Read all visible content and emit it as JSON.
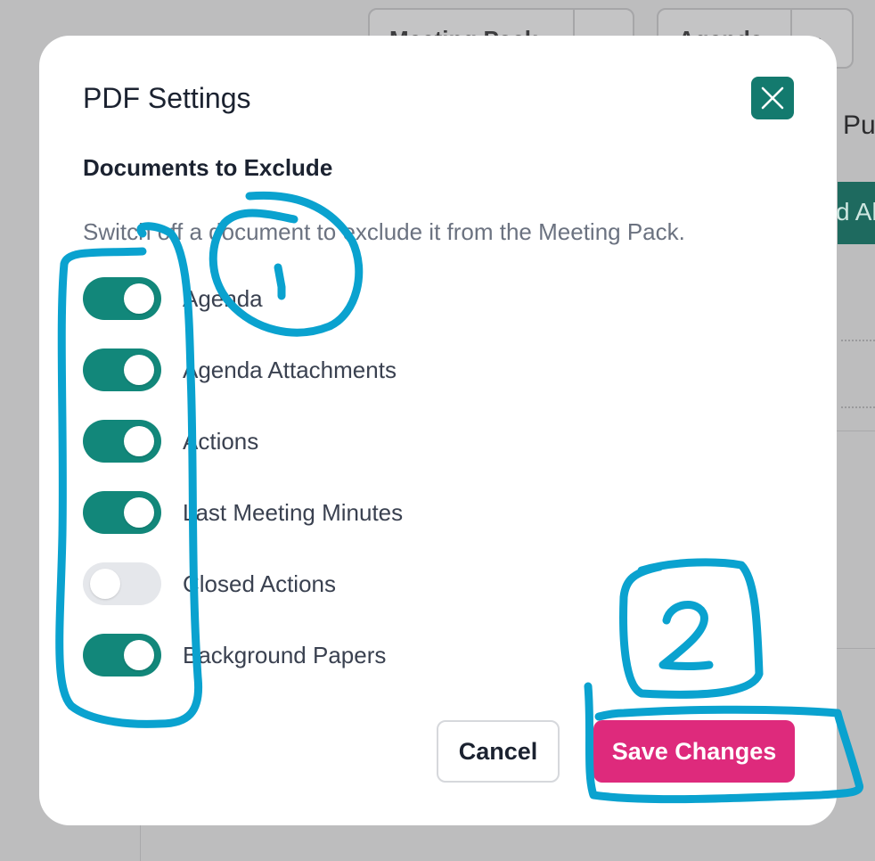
{
  "background": {
    "select1_text": "Meeting Pack",
    "select2_text": "Agenda",
    "partial_right_text": "Pu",
    "partial_green_text": "d Al"
  },
  "modal": {
    "title": "PDF Settings",
    "close_icon": "close-x-icon",
    "section_title": "Documents to Exclude",
    "hint": "Switch off a document to exclude it from the Meeting Pack.",
    "toggles": [
      {
        "label": "Agenda",
        "on": true
      },
      {
        "label": "Agenda Attachments",
        "on": true
      },
      {
        "label": "Actions",
        "on": true
      },
      {
        "label": "Last Meeting Minutes",
        "on": true
      },
      {
        "label": "Closed Actions",
        "on": false
      },
      {
        "label": "Background Papers",
        "on": true
      }
    ],
    "cancel_label": "Cancel",
    "save_label": "Save Changes"
  },
  "annotations": {
    "marker_1": "1",
    "marker_2": "2",
    "color": "#0aa2cf"
  },
  "colors": {
    "accent_green": "#12877a",
    "save_pink": "#de2a7c",
    "close_bg": "#137a6e"
  }
}
